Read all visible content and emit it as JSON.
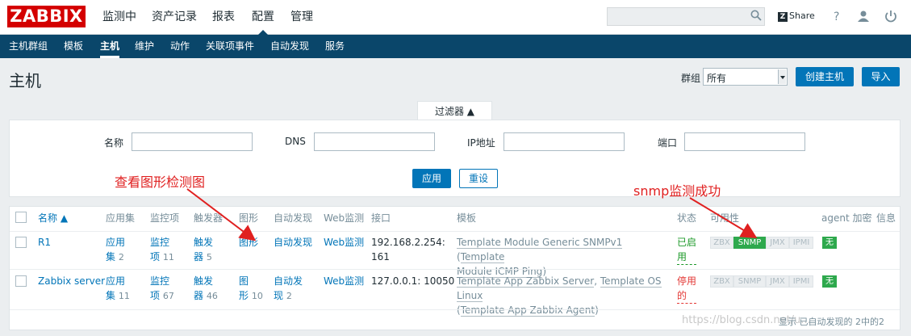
{
  "logo": "ZABBIX",
  "top_menu": [
    "监测中",
    "资产记录",
    "报表",
    "配置",
    "管理"
  ],
  "top_icons": {
    "share": "Share"
  },
  "sub_menu": [
    "主机群组",
    "模板",
    "主机",
    "维护",
    "动作",
    "关联项事件",
    "自动发现",
    "服务"
  ],
  "page": {
    "title": "主机",
    "group_label": "群组",
    "group_value": "所有",
    "create_button": "创建主机",
    "import_button": "导入"
  },
  "filter": {
    "tab_label": "过滤器 ▲",
    "name_label": "名称",
    "dns_label": "DNS",
    "ip_label": "IP地址",
    "port_label": "端口",
    "apply_button": "应用",
    "reset_button": "重设"
  },
  "table": {
    "headers": [
      "名称 ▲",
      "应用集",
      "监控项",
      "触发器",
      "图形",
      "自动发现",
      "Web监测",
      "接口",
      "模板",
      "状态",
      "可用性",
      "agent 加密",
      "信息"
    ],
    "rows": [
      {
        "name": "R1",
        "apps": "应用",
        "apps2": "集",
        "apps_count": "2",
        "items": "监控",
        "items2": "项",
        "items_count": "11",
        "triggers": "触发",
        "triggers2": "器",
        "triggers_count": "5",
        "graphs": "图形",
        "discovery": "自动发现",
        "web": "Web监测",
        "interface": "192.168.2.254:",
        "interface2": "161",
        "templates_line1a": "Template Module Generic SNMPv1",
        "templates_line1b": " (",
        "templates_line1c": "Template",
        "templates_line2a": "Module ICMP Ping",
        "templates_line2b": ")",
        "status": "已启",
        "status2": "用",
        "avail": [
          "ZBX",
          "SNMP",
          "JMX",
          "IPMI"
        ],
        "encrypt": "无"
      },
      {
        "name": "Zabbix server",
        "apps": "应用",
        "apps2": "集",
        "apps_count": "11",
        "items": "监控",
        "items2": "项",
        "items_count": "67",
        "triggers": "触发",
        "triggers2": "器",
        "triggers_count": "46",
        "graphs": "图",
        "graphs2": "形",
        "graphs_count": "10",
        "discovery": "自动发",
        "discovery2": "现",
        "discovery_count": "2",
        "web": "Web监测",
        "interface": "127.0.0.1: 10050",
        "templates_line1a": "Template App Zabbix Server",
        "templates_line1b": ", ",
        "templates_line1c": "Template OS Linux",
        "templates_line2a": "(",
        "templates_line2b": "Template App Zabbix Agent",
        "templates_line2c": ")",
        "status": "停用",
        "status2": "的",
        "avail": [
          "ZBX",
          "SNMP",
          "JMX",
          "IPMI"
        ],
        "encrypt": "无"
      }
    ],
    "footer": "显示 已自动发现的 2中的2"
  },
  "annotations": {
    "graph_note": "查看图形检测图",
    "snmp_note": "snmp监测成功"
  },
  "watermark": "https://blog.csdn.net/u..."
}
